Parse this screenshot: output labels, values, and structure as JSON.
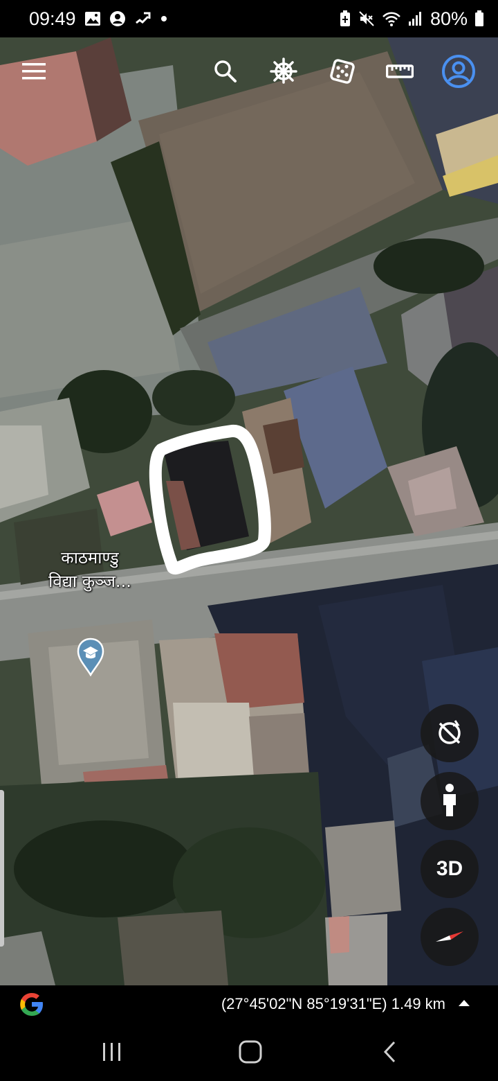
{
  "status_bar": {
    "time": "09:49",
    "battery_percent": "80%",
    "left_icons": [
      "gallery-icon",
      "account-circle-icon",
      "cast-icon",
      "dot-icon"
    ],
    "right_icons": [
      "battery-saver-icon",
      "mute-icon",
      "wifi-icon",
      "signal-icon",
      "battery-icon"
    ]
  },
  "toolbar": {
    "icons": [
      "menu-icon",
      "search-icon",
      "voyager-wheel-icon",
      "dice-icon",
      "ruler-icon",
      "profile-icon"
    ]
  },
  "map": {
    "place_label_line1": "काठमाण्डु",
    "place_label_line2": "विद्या कुञ्ज...",
    "place_type": "school-pin-icon",
    "highlight_color": "#ffffff"
  },
  "controls": {
    "compass_label": "3D",
    "buttons": [
      "rotation-lock-icon",
      "pegman-icon",
      "3d-button",
      "compass-icon"
    ]
  },
  "info_bar": {
    "coordinates": "(27°45'02\"N 85°19'31\"E) 1.49 km"
  },
  "colors": {
    "accent_blue": "#4a90f0",
    "fab_bg": "#191919"
  }
}
